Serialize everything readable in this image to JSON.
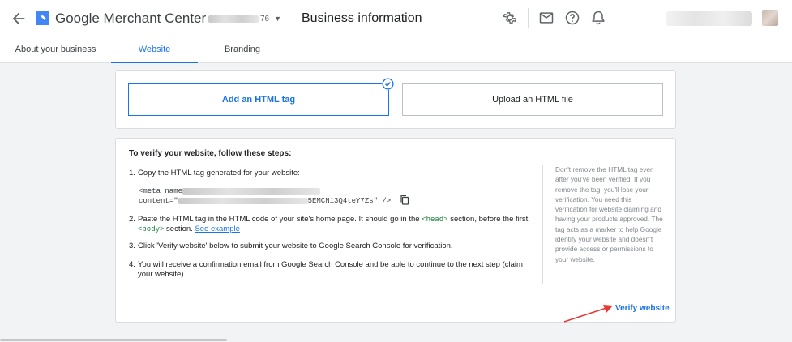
{
  "header": {
    "brand": "Google Merchant Center",
    "account_id": "76",
    "page_title": "Business information"
  },
  "tabs": [
    {
      "label": "About your business",
      "active": false
    },
    {
      "label": "Website",
      "active": true
    },
    {
      "label": "Branding",
      "active": false
    }
  ],
  "methods": {
    "html_tag": "Add an HTML tag",
    "html_file": "Upload an HTML file"
  },
  "steps": {
    "title": "To verify your website, follow these steps:",
    "s1_num": "1.",
    "s1": "Copy the HTML tag generated for your website:",
    "snippet_line1": "<meta name",
    "snippet_line2_a": "content=\"",
    "snippet_line2_b": "5EMCN13Q4teY7Zs\" />",
    "s2_num": "2.",
    "s2_a": "Paste the HTML tag in the HTML code of your site's home page. It should go in the ",
    "s2_head": "<head>",
    "s2_b": " section, before the first",
    "s2_body": "<body>",
    "s2_c": " section. ",
    "s2_link": "See example",
    "s3_num": "3.",
    "s3": "Click 'Verify website' below to submit your website to Google Search Console for verification.",
    "s4_num": "4.",
    "s4_a": "You will receive a confirmation email from Google Search Console and be able to continue to the next step (claim",
    "s4_b": "your website)."
  },
  "side_note": "Don't remove the HTML tag even after you've been verified. If you remove the tag, you'll lose your verification. You need this verification for website claiming and having your products approved. The tag acts as a marker to help Google identify your website and doesn't provide access or permissions to your website.",
  "verify_label": "Verify website",
  "colors": {
    "accent": "#1a73e8",
    "code_green": "#188038",
    "annotation_arrow": "#e53935"
  }
}
